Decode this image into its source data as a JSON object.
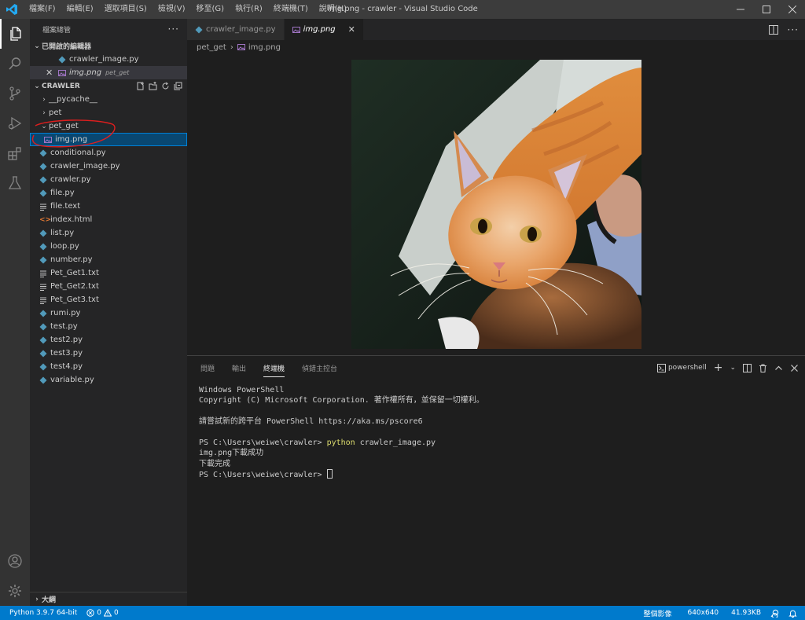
{
  "window": {
    "title": "img.png - crawler - Visual Studio Code",
    "menu": [
      "檔案(F)",
      "編輯(E)",
      "選取項目(S)",
      "檢視(V)",
      "移至(G)",
      "執行(R)",
      "終端機(T)",
      "說明(H)"
    ]
  },
  "sidebar": {
    "title": "檔案總管",
    "open_editors_label": "已開啟的編輯器",
    "open_editors": [
      {
        "name": "crawler_image.py",
        "desc": ""
      },
      {
        "name": "img.png",
        "desc": "pet_get"
      }
    ],
    "folder_label": "CRAWLER",
    "tree": {
      "pycache": "__pycache__",
      "pet": "pet",
      "pet_get": "pet_get",
      "img": "img.png",
      "files": [
        {
          "name": "conditional.py",
          "type": "py"
        },
        {
          "name": "crawler_image.py",
          "type": "py"
        },
        {
          "name": "crawler.py",
          "type": "py"
        },
        {
          "name": "file.py",
          "type": "py"
        },
        {
          "name": "file.text",
          "type": "txt"
        },
        {
          "name": "index.html",
          "type": "html"
        },
        {
          "name": "list.py",
          "type": "py"
        },
        {
          "name": "loop.py",
          "type": "py"
        },
        {
          "name": "number.py",
          "type": "py"
        },
        {
          "name": "Pet_Get1.txt",
          "type": "txt"
        },
        {
          "name": "Pet_Get2.txt",
          "type": "txt"
        },
        {
          "name": "Pet_Get3.txt",
          "type": "txt"
        },
        {
          "name": "rumi.py",
          "type": "py"
        },
        {
          "name": "test.py",
          "type": "py"
        },
        {
          "name": "test2.py",
          "type": "py"
        },
        {
          "name": "test3.py",
          "type": "py"
        },
        {
          "name": "test4.py",
          "type": "py"
        },
        {
          "name": "variable.py",
          "type": "py"
        }
      ]
    },
    "outline_label": "大綱"
  },
  "editor": {
    "tabs": [
      {
        "label": "crawler_image.py",
        "active": false
      },
      {
        "label": "img.png",
        "active": true
      }
    ],
    "breadcrumb": [
      "pet_get",
      "img.png"
    ]
  },
  "panel": {
    "tabs": [
      "問題",
      "輸出",
      "終端機",
      "偵錯主控台"
    ],
    "active_tab": "終端機",
    "terminal_name": "powershell",
    "terminal": {
      "line1": "Windows PowerShell",
      "line2": "Copyright (C) Microsoft Corporation. 著作權所有，並保留一切權利。",
      "line3": "請嘗試新的跨平台 PowerShell https://aka.ms/pscore6",
      "prompt": "PS C:\\Users\\weiwe\\crawler> ",
      "command": "python",
      "command_args": " crawler_image.py",
      "out1": "img.png下載成功",
      "out2": "下載完成",
      "prompt2": "PS C:\\Users\\weiwe\\crawler> "
    }
  },
  "statusbar": {
    "python": "Python 3.9.7 64-bit",
    "errors": "0",
    "warnings": "0",
    "image_mode": "整個影像",
    "dimensions": "640x640",
    "size": "41.93KB"
  },
  "colors": {
    "accent": "#007acc",
    "selection": "#094771",
    "annotation": "#e01e1e"
  }
}
